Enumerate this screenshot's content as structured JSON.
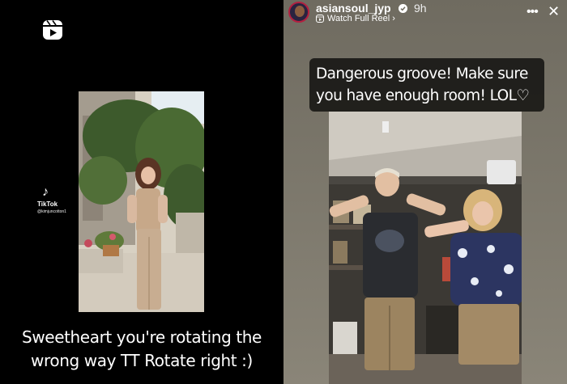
{
  "left_story": {
    "reels_icon": "reels-icon",
    "tiktok": {
      "name": "TikTok",
      "handle": "@kimjuncotton1"
    },
    "caption": "Sweetheart you're rotating the wrong way TT Rotate right :)"
  },
  "right_story": {
    "username": "asiansoul_jyp",
    "timestamp": "9h",
    "watch_label": "Watch Full Reel ›",
    "more_icon": "more-icon",
    "close_icon": "close-icon",
    "caption": "Dangerous groove! Make sure you have enough room! LOL♡"
  }
}
